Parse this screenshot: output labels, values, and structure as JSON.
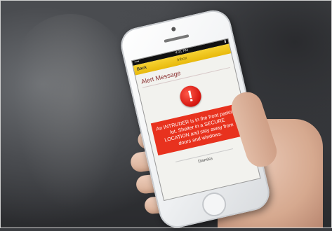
{
  "phone": {
    "status": {
      "carrier": "•••• ",
      "time": "4:21 PM",
      "battery": "▮"
    },
    "nav": {
      "back_label": "Back",
      "title": "Inbox"
    },
    "alert": {
      "header": "Alert Message",
      "icon_symbol": "!",
      "message": "An INTRUDER is in the front parking lot. Shelter in a SECURE LOCATION and stay away from doors and windows.",
      "dismiss_label": "Dismiss"
    }
  },
  "colors": {
    "nav_bar": "#f0c419",
    "alert_box": "#e8321e",
    "alert_icon": "#d4140e"
  },
  "icons": {
    "alert": "exclamation-circle-icon",
    "home": "home-button-circle"
  }
}
